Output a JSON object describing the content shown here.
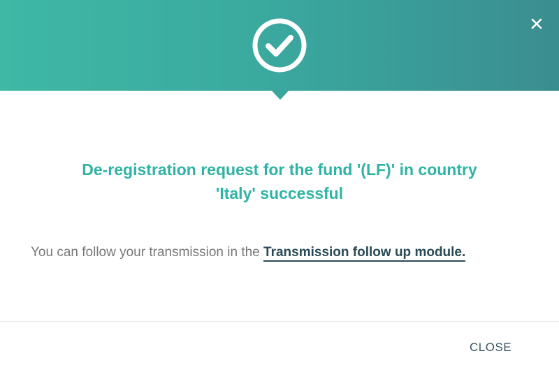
{
  "dialog": {
    "icon": "checkmark-circle-icon",
    "dismiss_icon": "close-icon",
    "title_line1": "De-registration request for the fund '(LF)' in country",
    "title_line2": "'Italy' successful",
    "message_text": "You can follow your transmission in the ",
    "message_link": "Transmission follow up module.",
    "close_label": "CLOSE"
  },
  "colors": {
    "header_gradient_start": "#3fb8a6",
    "header_gradient_end": "#3b8d90",
    "title": "#2fb3a4",
    "link": "#2a4a55"
  }
}
